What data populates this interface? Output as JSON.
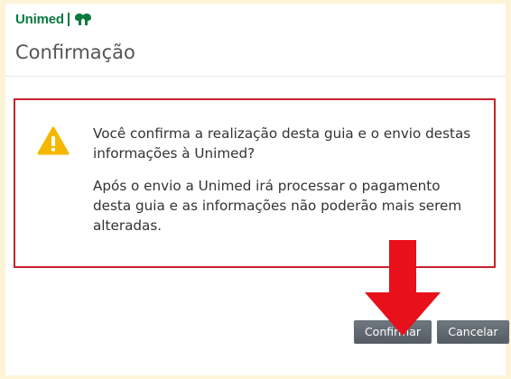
{
  "logo": {
    "brand": "Unimed",
    "symbol": "tree-icon"
  },
  "page": {
    "title": "Confirmação"
  },
  "dialog": {
    "icon": "warning-icon",
    "line1": "Você confirma a realização desta guia e o envio destas informações à Unimed?",
    "line2": "Após o envio a Unimed irá processar o pagamento desta guia e as informações não poderão mais serem alteradas."
  },
  "buttons": {
    "confirm_label": "Confirmar",
    "cancel_label": "Cancelar"
  },
  "annotation": {
    "arrow": "arrow-down-icon",
    "color": "#e8101a"
  },
  "colors": {
    "brand": "#0a7a3e",
    "border": "#c8232c",
    "warning": "#f5b800",
    "button": "#5f6770",
    "background": "#fdf3d6"
  }
}
